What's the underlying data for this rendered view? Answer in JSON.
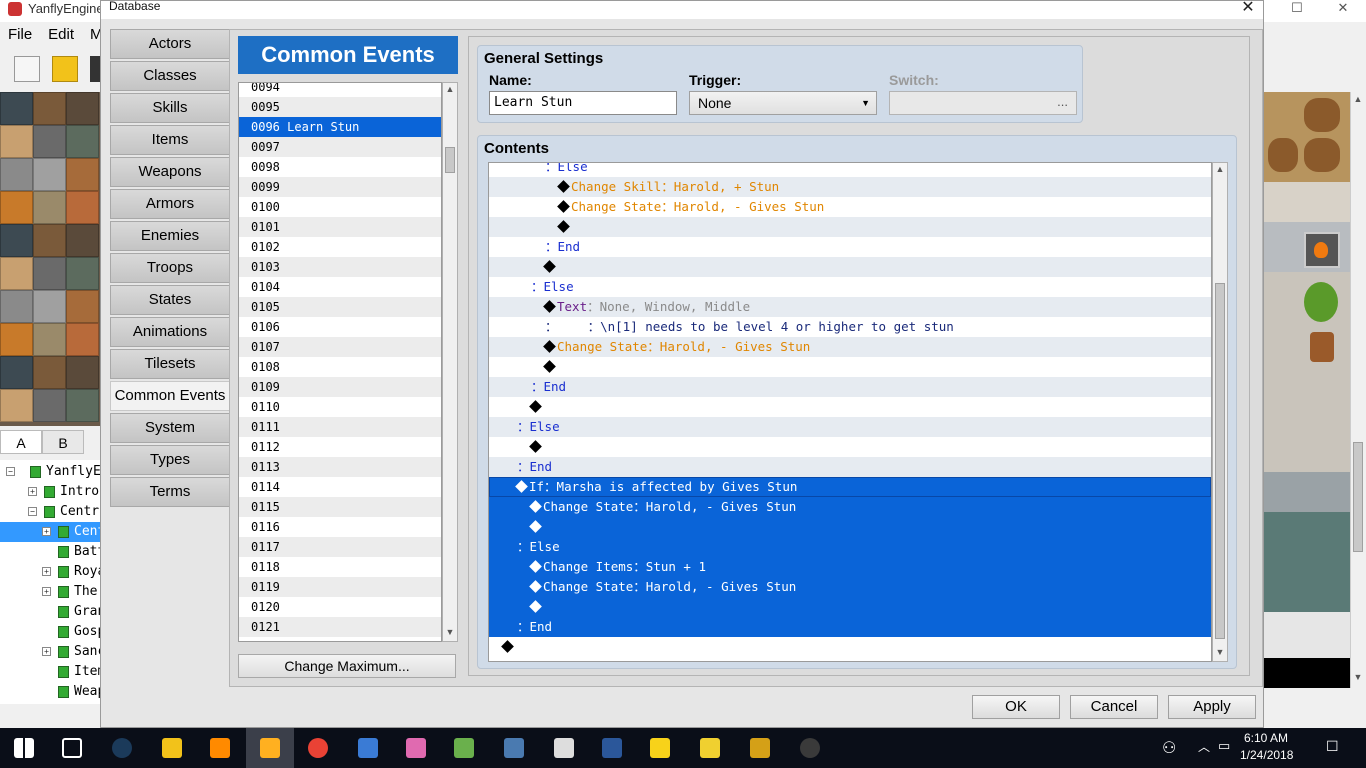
{
  "background_app": {
    "title": "YanflyEngine",
    "menu": [
      "File",
      "Edit",
      "M"
    ],
    "tile_tabs": [
      "A",
      "B"
    ],
    "map_tree": [
      {
        "label": "YanflyEng",
        "indent": 0,
        "expander": "−"
      },
      {
        "label": "Intro Ma",
        "indent": 1,
        "expander": "+"
      },
      {
        "label": "Central",
        "indent": 1,
        "expander": "−"
      },
      {
        "label": "Centra",
        "indent": 2,
        "expander": "+",
        "selected": true
      },
      {
        "label": "Battle",
        "indent": 2,
        "expander": ""
      },
      {
        "label": "Royal L",
        "indent": 2,
        "expander": "+"
      },
      {
        "label": "The Aca",
        "indent": 2,
        "expander": "+"
      },
      {
        "label": "Grand C",
        "indent": 2,
        "expander": ""
      },
      {
        "label": "Gospel",
        "indent": 2,
        "expander": ""
      },
      {
        "label": "Sanctua",
        "indent": 2,
        "expander": "+"
      },
      {
        "label": "Item Sh",
        "indent": 2,
        "expander": ""
      },
      {
        "label": "Weapon",
        "indent": 2,
        "expander": ""
      }
    ]
  },
  "dialog": {
    "title": "Database",
    "close_glyph": "✕",
    "categories": [
      "Actors",
      "Classes",
      "Skills",
      "Items",
      "Weapons",
      "Armors",
      "Enemies",
      "Troops",
      "States",
      "Animations",
      "Tilesets",
      "Common Events",
      "System",
      "Types",
      "Terms"
    ],
    "active_category": "Common Events",
    "list_header": "Common Events",
    "list_items": [
      "0094",
      "0095",
      "0096 Learn Stun",
      "0097",
      "0098",
      "0099",
      "0100",
      "0101",
      "0102",
      "0103",
      "0104",
      "0105",
      "0106",
      "0107",
      "0108",
      "0109",
      "0110",
      "0111",
      "0112",
      "0113",
      "0114",
      "0115",
      "0116",
      "0117",
      "0118",
      "0119",
      "0120",
      "0121"
    ],
    "selected_item": "0096 Learn Stun",
    "change_max_label": "Change Maximum...",
    "general": {
      "title": "General Settings",
      "name_label": "Name:",
      "name_value": "Learn Stun",
      "trigger_label": "Trigger:",
      "trigger_value": "None",
      "switch_label": "Switch:",
      "switch_dots": "..."
    },
    "contents": {
      "title": "Contents",
      "commands": [
        {
          "indent": 3,
          "diamond": false,
          "parts": [
            {
              "t": "：Else",
              "c": "blue"
            }
          ]
        },
        {
          "indent": 4,
          "diamond": true,
          "parts": [
            {
              "t": "Change Skill：Harold, + Stun",
              "c": "orange"
            }
          ]
        },
        {
          "indent": 4,
          "diamond": true,
          "parts": [
            {
              "t": "Change State：Harold, - Gives Stun",
              "c": "orange"
            }
          ]
        },
        {
          "indent": 4,
          "diamond": true,
          "parts": []
        },
        {
          "indent": 3,
          "diamond": false,
          "parts": [
            {
              "t": "：End",
              "c": "blue"
            }
          ]
        },
        {
          "indent": 3,
          "diamond": true,
          "parts": []
        },
        {
          "indent": 2,
          "diamond": false,
          "parts": [
            {
              "t": "：Else",
              "c": "blue"
            }
          ]
        },
        {
          "indent": 3,
          "diamond": true,
          "parts": [
            {
              "t": "Text",
              "c": "purple"
            },
            {
              "t": "：None, Window, Middle",
              "c": "gray"
            }
          ]
        },
        {
          "indent": 3,
          "diamond": false,
          "parts": [
            {
              "t": "：    ：\\n[1] needs to be level 4 or higher to get stun",
              "c": "dark"
            }
          ]
        },
        {
          "indent": 3,
          "diamond": true,
          "parts": [
            {
              "t": "Change State：Harold, - Gives Stun",
              "c": "orange"
            }
          ]
        },
        {
          "indent": 3,
          "diamond": true,
          "parts": []
        },
        {
          "indent": 2,
          "diamond": false,
          "parts": [
            {
              "t": "：End",
              "c": "blue"
            }
          ]
        },
        {
          "indent": 2,
          "diamond": true,
          "parts": []
        },
        {
          "indent": 1,
          "diamond": false,
          "parts": [
            {
              "t": "：Else",
              "c": "blue"
            }
          ]
        },
        {
          "indent": 2,
          "diamond": true,
          "parts": []
        },
        {
          "indent": 1,
          "diamond": false,
          "parts": [
            {
              "t": "：End",
              "c": "blue"
            }
          ]
        },
        {
          "indent": 1,
          "diamond": true,
          "selected": true,
          "parts": [
            {
              "t": "If：Marsha is affected by Gives Stun",
              "c": "blue"
            }
          ]
        },
        {
          "indent": 2,
          "diamond": true,
          "selected": true,
          "parts": [
            {
              "t": "Change State：Harold, - Gives Stun",
              "c": "orange"
            }
          ]
        },
        {
          "indent": 2,
          "diamond": true,
          "selected": true,
          "parts": []
        },
        {
          "indent": 1,
          "diamond": false,
          "selected": true,
          "parts": [
            {
              "t": "：Else",
              "c": "blue"
            }
          ]
        },
        {
          "indent": 2,
          "diamond": true,
          "selected": true,
          "parts": [
            {
              "t": "Change Items：Stun + 1",
              "c": "orange"
            }
          ]
        },
        {
          "indent": 2,
          "diamond": true,
          "selected": true,
          "parts": [
            {
              "t": "Change State：Harold, - Gives Stun",
              "c": "orange"
            }
          ]
        },
        {
          "indent": 2,
          "diamond": true,
          "selected": true,
          "parts": []
        },
        {
          "indent": 1,
          "diamond": false,
          "selected": true,
          "parts": [
            {
              "t": "：End",
              "c": "blue"
            }
          ]
        },
        {
          "indent": 0,
          "diamond": true,
          "parts": []
        }
      ]
    },
    "buttons": {
      "ok": "OK",
      "cancel": "Cancel",
      "apply": "Apply"
    }
  },
  "taskbar": {
    "time": "6:10 AM",
    "date": "1/24/2018",
    "apps": [
      "windows-start",
      "task-view",
      "steam",
      "file-explorer",
      "sublime",
      "rpg-maker",
      "chrome",
      "control-panel",
      "paint-app",
      "notepad-app",
      "remote-app",
      "calculator",
      "word",
      "folder-app",
      "yellow-app",
      "star-app",
      "obs"
    ]
  },
  "colors": {
    "accent": "#1e6fc4",
    "selection": "#0a64d8",
    "else_end": "#1a2fd0",
    "command": "#e08600"
  }
}
